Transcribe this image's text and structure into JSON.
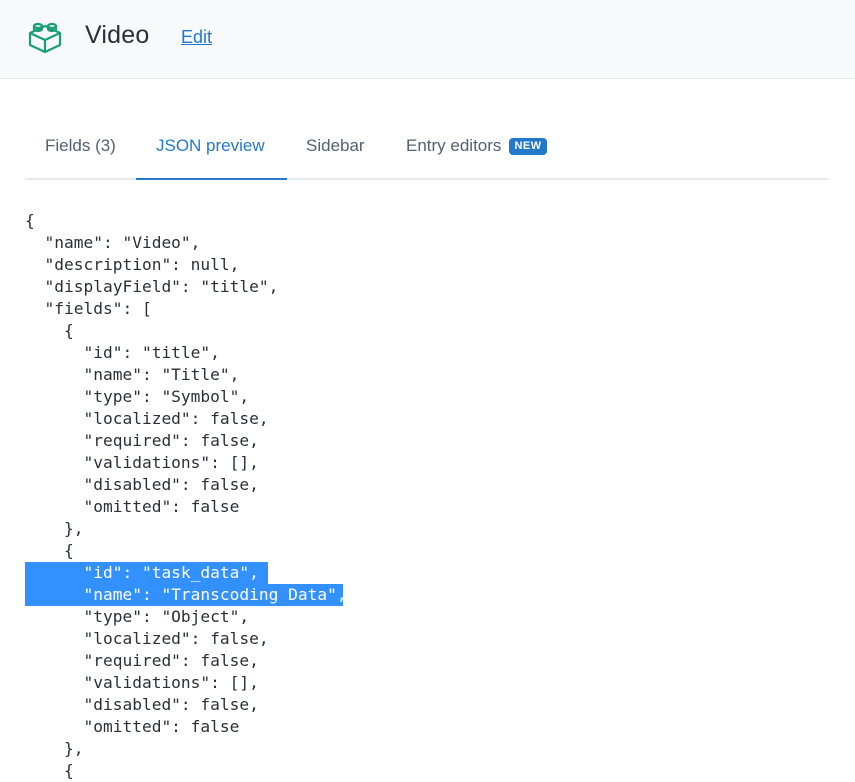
{
  "header": {
    "title": "Video",
    "edit_label": "Edit"
  },
  "tabs": [
    {
      "label": "Fields (3)"
    },
    {
      "label": "JSON preview"
    },
    {
      "label": "Sidebar"
    },
    {
      "label": "Entry editors",
      "badge": "NEW"
    }
  ],
  "active_tab": "JSON preview",
  "json_preview": {
    "lines": [
      "{",
      "  \"name\": \"Video\",",
      "  \"description\": null,",
      "  \"displayField\": \"title\",",
      "  \"fields\": [",
      "    {",
      "      \"id\": \"title\",",
      "      \"name\": \"Title\",",
      "      \"type\": \"Symbol\",",
      "      \"localized\": false,",
      "      \"required\": false,",
      "      \"validations\": [],",
      "      \"disabled\": false,",
      "      \"omitted\": false",
      "    },",
      "    {",
      "      \"id\": \"task_data\",",
      "      \"name\": \"Transcoding Data\",",
      "      \"type\": \"Object\",",
      "      \"localized\": false,",
      "      \"required\": false,",
      "      \"validations\": [],",
      "      \"disabled\": false,",
      "      \"omitted\": false",
      "    },",
      "    {"
    ],
    "selected_lines": [
      16,
      17
    ]
  },
  "colors": {
    "accent": "#2478cc",
    "selection": "#3390ff",
    "icon": "#1b9e77"
  }
}
